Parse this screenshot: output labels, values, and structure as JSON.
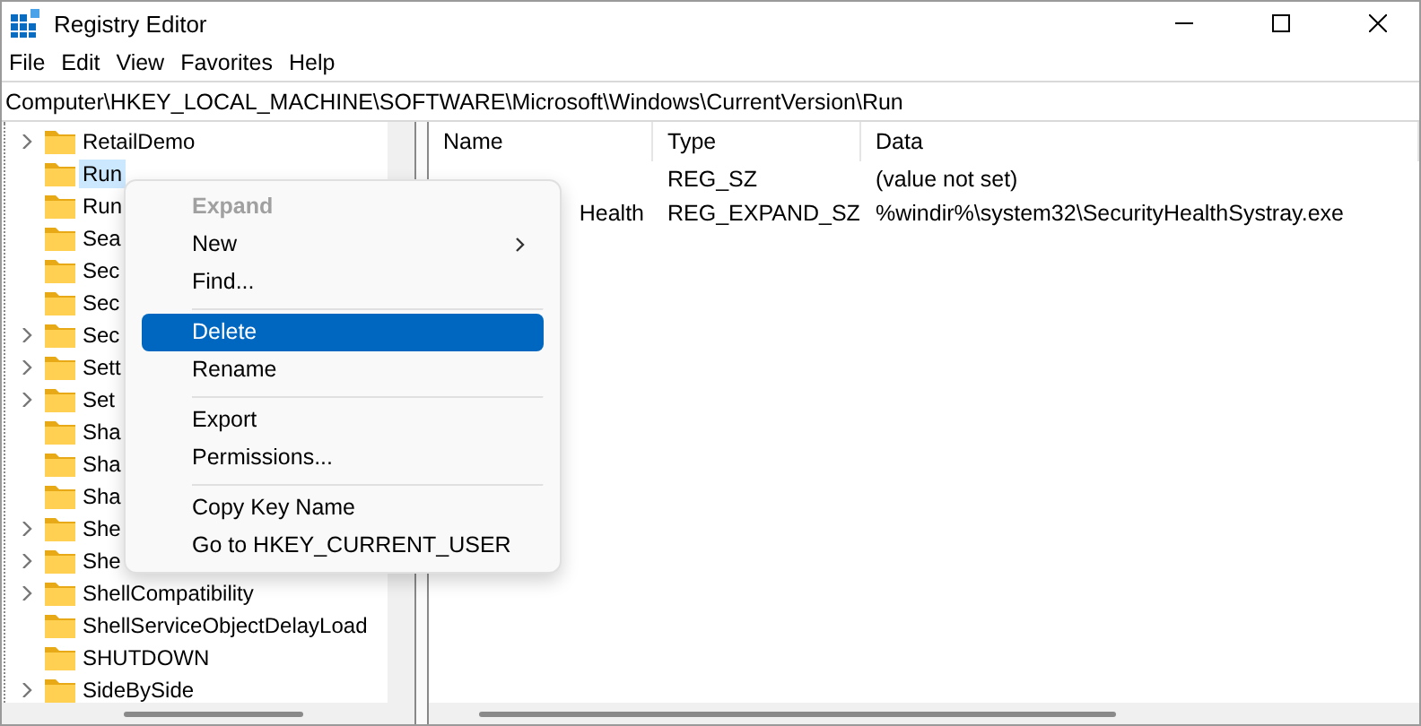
{
  "window": {
    "title": "Registry Editor"
  },
  "menu_bar": [
    "File",
    "Edit",
    "View",
    "Favorites",
    "Help"
  ],
  "address": "Computer\\HKEY_LOCAL_MACHINE\\SOFTWARE\\Microsoft\\Windows\\CurrentVersion\\Run",
  "tree": [
    {
      "label": "RetailDemo",
      "expandable": true,
      "selected": false
    },
    {
      "label": "Run",
      "expandable": false,
      "selected": true
    },
    {
      "label": "Run",
      "expandable": false,
      "selected": false
    },
    {
      "label": "Sea",
      "expandable": false,
      "selected": false
    },
    {
      "label": "Sec",
      "expandable": false,
      "selected": false
    },
    {
      "label": "Sec",
      "expandable": false,
      "selected": false
    },
    {
      "label": "Sec",
      "expandable": true,
      "selected": false
    },
    {
      "label": "Sett",
      "expandable": true,
      "selected": false
    },
    {
      "label": "Set",
      "expandable": true,
      "selected": false
    },
    {
      "label": "Sha",
      "expandable": false,
      "selected": false
    },
    {
      "label": "Sha",
      "expandable": false,
      "selected": false
    },
    {
      "label": "Sha",
      "expandable": false,
      "selected": false
    },
    {
      "label": "She",
      "expandable": true,
      "selected": false
    },
    {
      "label": "She",
      "expandable": true,
      "selected": false
    },
    {
      "label": "ShellCompatibility",
      "expandable": true,
      "selected": false
    },
    {
      "label": "ShellServiceObjectDelayLoad",
      "expandable": false,
      "selected": false
    },
    {
      "label": "SHUTDOWN",
      "expandable": false,
      "selected": false
    },
    {
      "label": "SideBySide",
      "expandable": true,
      "selected": false
    }
  ],
  "table": {
    "columns": [
      "Name",
      "Type",
      "Data"
    ],
    "rows": [
      {
        "type": "REG_SZ",
        "data": "(value not set)"
      },
      {
        "name": "Health",
        "type": "REG_EXPAND_SZ",
        "data": "%windir%\\system32\\SecurityHealthSystray.exe"
      }
    ]
  },
  "context_menu": [
    {
      "label": "Expand",
      "disabled": true,
      "selected": false,
      "submenu": false
    },
    {
      "label": "New",
      "disabled": false,
      "selected": false,
      "submenu": true
    },
    {
      "label": "Find...",
      "disabled": false,
      "selected": false,
      "submenu": false,
      "separator_after": true
    },
    {
      "label": "Delete",
      "disabled": false,
      "selected": true,
      "submenu": false
    },
    {
      "label": "Rename",
      "disabled": false,
      "selected": false,
      "submenu": false,
      "separator_after": true
    },
    {
      "label": "Export",
      "disabled": false,
      "selected": false,
      "submenu": false
    },
    {
      "label": "Permissions...",
      "disabled": false,
      "selected": false,
      "submenu": false,
      "separator_after": true
    },
    {
      "label": "Copy Key Name",
      "disabled": false,
      "selected": false,
      "submenu": false
    },
    {
      "label": "Go to HKEY_CURRENT_USER",
      "disabled": false,
      "selected": false,
      "submenu": false
    }
  ]
}
